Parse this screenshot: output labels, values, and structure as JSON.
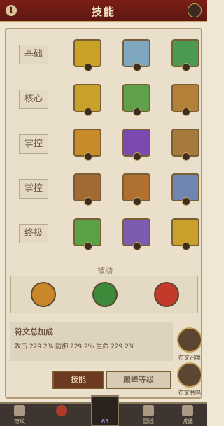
{
  "header": {
    "title": "技能",
    "info": "i"
  },
  "rows": [
    {
      "label": "基础",
      "slots": [
        {
          "color": "#c9a126"
        },
        {
          "color": "#7fa6bf"
        },
        {
          "color": "#4a9a52"
        }
      ]
    },
    {
      "label": "核心",
      "slots": [
        {
          "color": "#c7a12a"
        },
        {
          "color": "#5fa04a"
        },
        {
          "color": "#b3803a"
        }
      ]
    },
    {
      "label": "掌控",
      "slots": [
        {
          "color": "#c98a2a"
        },
        {
          "color": "#7a4ab0"
        },
        {
          "color": "#a57a3a"
        }
      ]
    },
    {
      "label": "掌控",
      "slots": [
        {
          "color": "#a06a32"
        },
        {
          "color": "#b07030"
        },
        {
          "color": "#6f86b3"
        }
      ]
    },
    {
      "label": "终极",
      "slots": [
        {
          "color": "#5aa044"
        },
        {
          "color": "#7c5cb0"
        },
        {
          "color": "#c8a02a"
        }
      ]
    }
  ],
  "passive": {
    "title": "被动",
    "icons": [
      {
        "name": "ram-passive-icon",
        "color": "#c9872a"
      },
      {
        "name": "leaf-passive-icon",
        "color": "#3f8a3a"
      },
      {
        "name": "fire-passive-icon",
        "color": "#c33a2a"
      }
    ]
  },
  "bonus": {
    "title": "符文总加成",
    "attack_label": "攻击",
    "attack_value": "229.2%",
    "defense_label": "防御",
    "defense_value": "229.2%",
    "hp_label": "生命",
    "hp_value": "229.2%"
  },
  "side": {
    "btn1": "符文召唤",
    "btn2": "符文共鸣"
  },
  "tabs": {
    "active": "技能",
    "other": "巅峰等级"
  },
  "nav": {
    "item1": "符纹",
    "item4": "冒险",
    "item5": "城堡",
    "gems": "65"
  }
}
